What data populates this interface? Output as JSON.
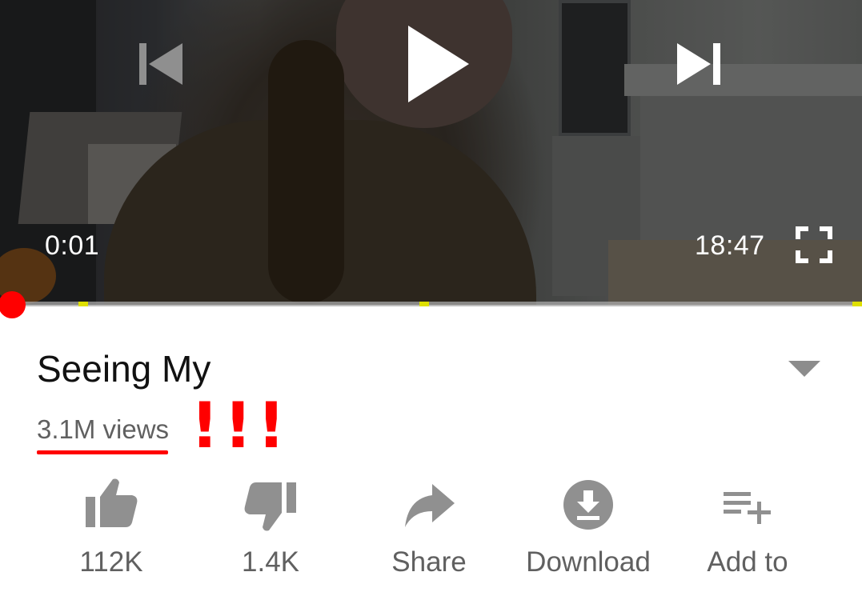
{
  "player": {
    "current_time": "0:01",
    "duration": "18:47",
    "played_fraction": 0.0009,
    "icons": {
      "previous": "skip-previous-icon",
      "play": "play-icon",
      "next": "skip-next-icon",
      "fullscreen": "fullscreen-icon"
    },
    "colors": {
      "progress_played": "#ff0000",
      "progress_marker": "#dfe000"
    }
  },
  "video": {
    "title": "Seeing My",
    "views": "3.1M views",
    "annotation": "!!!",
    "annotation_color": "#ff0000"
  },
  "actions": [
    {
      "icon": "thumbs-up-icon",
      "label": "112K"
    },
    {
      "icon": "thumbs-down-icon",
      "label": "1.4K"
    },
    {
      "icon": "share-icon",
      "label": "Share"
    },
    {
      "icon": "download-icon",
      "label": "Download"
    },
    {
      "icon": "add-to-playlist-icon",
      "label": "Add to"
    }
  ]
}
